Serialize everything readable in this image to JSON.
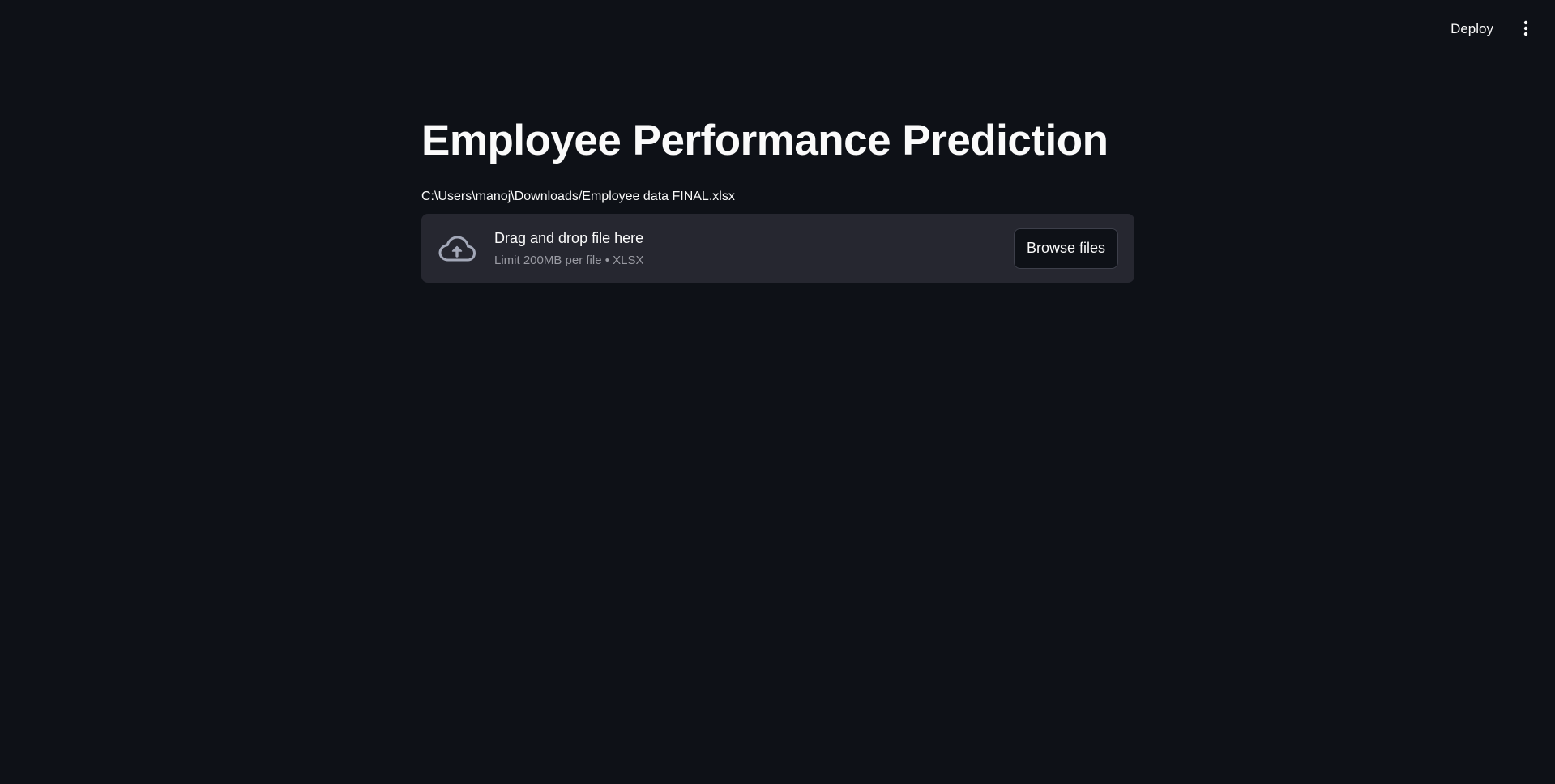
{
  "header": {
    "deploy_label": "Deploy",
    "menu_icon": "more-vertical-icon"
  },
  "main": {
    "title": "Employee Performance Prediction",
    "file_path": "C:\\Users\\manoj\\Downloads/Employee data FINAL.xlsx",
    "uploader": {
      "icon": "cloud-upload-icon",
      "title": "Drag and drop file here",
      "limit": "Limit 200MB per file • XLSX",
      "browse_label": "Browse files"
    }
  },
  "colors": {
    "background": "#0e1117",
    "dropzone": "#262730",
    "text": "#fafafa",
    "muted_text": "#9a9ba3"
  }
}
